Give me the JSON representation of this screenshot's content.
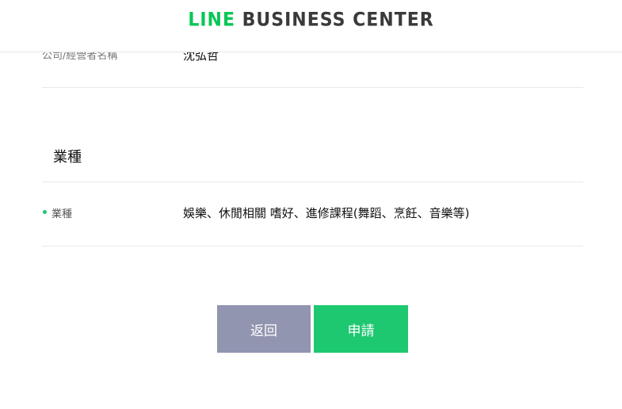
{
  "header": {
    "logo_line": "LINE",
    "logo_rest": " BUSINESS CENTER"
  },
  "company": {
    "label": "公司/經營者名稱",
    "value": "沈弘哲"
  },
  "industry_section": {
    "title": "業種",
    "field_label": "業種",
    "field_value": "娛樂、休閒相關 嗜好、進修課程(舞蹈、烹飪、音樂等)"
  },
  "actions": {
    "back_label": "返回",
    "apply_label": "申請"
  },
  "colors": {
    "accent_green": "#1ec870",
    "logo_green": "#06c755",
    "back_button": "#9295b0"
  }
}
